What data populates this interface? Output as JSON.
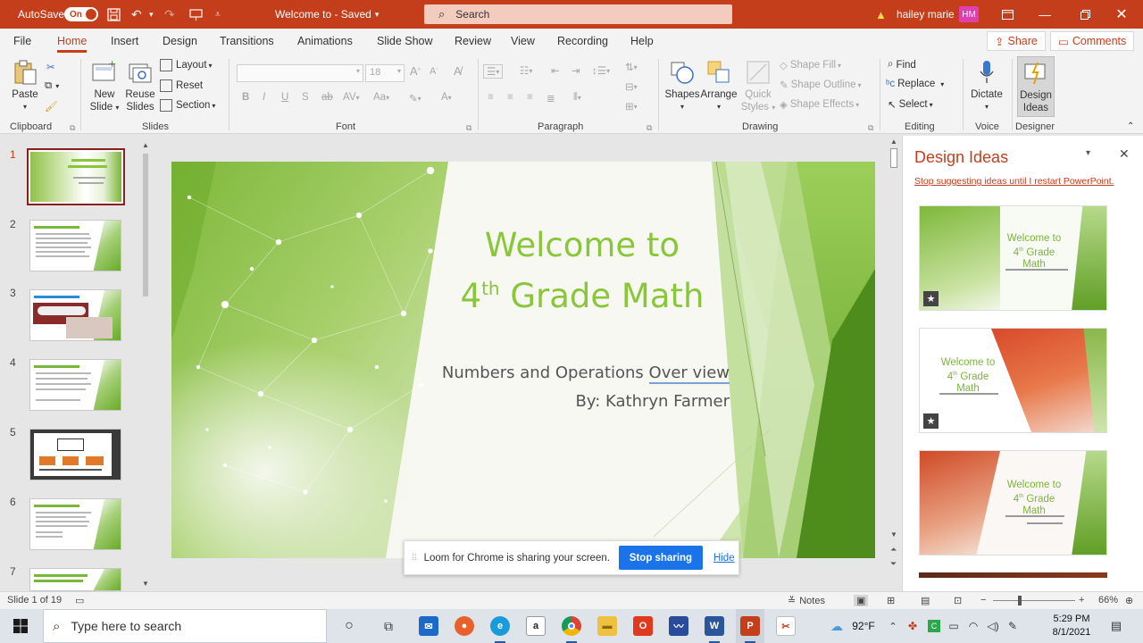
{
  "titlebar": {
    "autosave_label": "AutoSave",
    "autosave_state": "On",
    "document_title": "Welcome to  -  Saved",
    "title_caret": "⌄",
    "search_placeholder": "Search",
    "user_name": "hailey marie",
    "user_initials": "HM"
  },
  "tabs": [
    "File",
    "Home",
    "Insert",
    "Design",
    "Transitions",
    "Animations",
    "Slide Show",
    "Review",
    "View",
    "Recording",
    "Help"
  ],
  "active_tab": "Home",
  "share_label": "Share",
  "comments_label": "Comments",
  "ribbon": {
    "clipboard": {
      "paste": "Paste",
      "group": "Clipboard"
    },
    "slides": {
      "new_slide_1": "New",
      "new_slide_2": "Slide",
      "reuse_1": "Reuse",
      "reuse_2": "Slides",
      "layout": "Layout",
      "reset": "Reset",
      "section": "Section",
      "group": "Slides"
    },
    "font": {
      "font_size": "18",
      "group": "Font"
    },
    "paragraph": {
      "group": "Paragraph"
    },
    "drawing": {
      "shapes": "Shapes",
      "arrange": "Arrange",
      "quick_1": "Quick",
      "quick_2": "Styles",
      "fill": "Shape Fill",
      "outline": "Shape Outline",
      "effects": "Shape Effects",
      "group": "Drawing"
    },
    "editing": {
      "find": "Find",
      "replace": "Replace",
      "select": "Select",
      "group": "Editing"
    },
    "voice": {
      "dictate": "Dictate",
      "group": "Voice"
    },
    "designer": {
      "ideas_1": "Design",
      "ideas_2": "Ideas",
      "group": "Designer"
    }
  },
  "slide_numbers": [
    "1",
    "2",
    "3",
    "4",
    "5",
    "6",
    "7"
  ],
  "slide": {
    "title_line1": "Welcome to",
    "title_line2_num": "4",
    "title_line2_sup": "th",
    "title_line2_rest": " Grade Math",
    "subtitle_line1_a": "Numbers and Operations ",
    "subtitle_line1_b": "Over view",
    "subtitle_line2": "By: Kathryn Farmer"
  },
  "design_pane": {
    "title": "Design Ideas",
    "stop_link": "Stop suggesting ideas until I restart PowerPoint.",
    "card_title_1": "Welcome to",
    "card_title_sup": "4",
    "card_title_th": "th",
    "card_title_2": " Grade",
    "card_title_3": "Math"
  },
  "sharebar": {
    "message": "Loom for Chrome is sharing your screen.",
    "stop_label": "Stop sharing",
    "hide_label": "Hide"
  },
  "status": {
    "slide_info": "Slide 1 of 19",
    "notes_label": "Notes",
    "zoom": "66%"
  },
  "taskbar": {
    "search_placeholder": "Type here to search",
    "temperature": "92°F",
    "time": "5:29 PM",
    "date": "8/1/2021"
  },
  "colors": {
    "accent": "#c43e1c",
    "slide_green": "#8ac63a",
    "loom_blue": "#1a73e8"
  }
}
